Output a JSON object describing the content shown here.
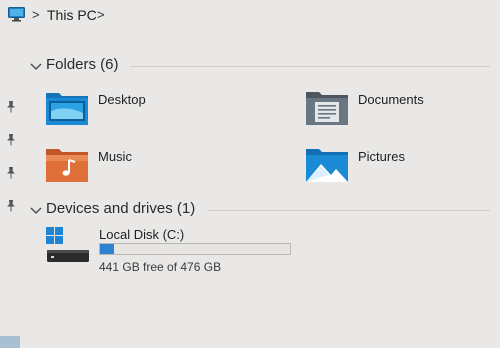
{
  "breadcrumb": {
    "location_icon": "monitor-icon",
    "items": [
      "This PC"
    ],
    "separator": ">"
  },
  "pinned_icons": [
    "pin-icon",
    "pin-icon",
    "pin-icon",
    "pin-icon"
  ],
  "folders_group": {
    "title": "Folders (6)",
    "expanded": true,
    "items": [
      {
        "label": "Desktop",
        "icon": "desktop-folder-icon"
      },
      {
        "label": "Documents",
        "icon": "documents-folder-icon"
      },
      {
        "label": "Music",
        "icon": "music-folder-icon"
      },
      {
        "label": "Pictures",
        "icon": "pictures-folder-icon"
      }
    ]
  },
  "drives_group": {
    "title": "Devices and drives (1)",
    "expanded": true,
    "drives": [
      {
        "label": "Local Disk (C:)",
        "icon": "windows-drive-icon",
        "free_text": "441 GB free of 476 GB",
        "used_fraction": 0.074
      }
    ]
  },
  "colors": {
    "background": "#e9e8e6",
    "drive_bar_fill": "#2e82d6",
    "folder_blue": "#1a8ad4",
    "music_orange": "#e0703a"
  }
}
